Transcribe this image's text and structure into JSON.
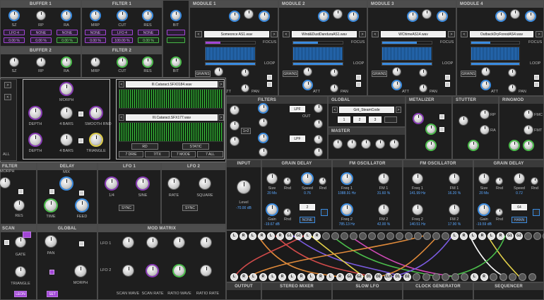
{
  "colors": {
    "purple": "#8a3bb8",
    "green": "#4bbd4b",
    "blue": "#3a8be0",
    "yellow": "#e2d04a",
    "cable_colors": [
      "#e08a3a",
      "#d04a4a",
      "#7a5be0",
      "#e2d04a",
      "#4bbd4b",
      "#d24ab8",
      "#ffffff"
    ]
  },
  "buffer1": {
    "title": "BUFFER 1",
    "knobs": [
      "SZ",
      "RP",
      "RA"
    ],
    "pills": [
      "LFO 4",
      "NONE",
      "NONE"
    ],
    "pcts": [
      "0.00 %",
      "0.00 %",
      "0.00 %"
    ]
  },
  "filter1": {
    "title": "FILTER 1",
    "knobs": [
      "MRP",
      "CUT",
      "RES"
    ],
    "pills": [
      "NONE",
      "LFO 4",
      "NONE"
    ],
    "pcts": [
      "0.00 %",
      "100.00 %",
      "0.00 %"
    ]
  },
  "buffer2": {
    "title": "BUFFER 2",
    "knobs": [
      "SZ",
      "RP",
      "RA"
    ]
  },
  "filter2": {
    "title": "FILTER 2",
    "knobs": [
      "MRP",
      "CUT",
      "RES"
    ]
  },
  "bit": {
    "label": "BIT"
  },
  "modules": [
    {
      "title": "MODULE 1",
      "file": "Someonce AS1.wav",
      "focus": "FOCUS",
      "loop": "LOOP",
      "grains": "GRAINS"
    },
    {
      "title": "MODULE 2",
      "file": "Wind&DustDanduraAS1.wav",
      "focus": "FOCUS",
      "loop": "LOOP",
      "grains": "GRAINS"
    },
    {
      "title": "MODULE 3",
      "file": "WChimeAS14.wav",
      "focus": "FOCUS",
      "loop": "LOOP",
      "grains": "GRAINS"
    },
    {
      "title": "MODULE 4",
      "file": "OutbackDryForestAS4.wav",
      "focus": "FOCUS",
      "loop": "LOOP",
      "grains": "GRAINS"
    }
  ],
  "module_labels": {
    "att": "ATT",
    "pan": "PAN",
    "flt1": "FLT1",
    "m": "M",
    "ft": "FT"
  },
  "sampler": {
    "knobs": [
      "MORPH",
      "DEPTH",
      "4 BARS",
      "SMOOTH RND",
      "DEPTH",
      "4 BARS",
      "TRIANGLE"
    ],
    "files": [
      "III.Cataract.SFX0184.wav",
      "III.Cataract.SFX177.wav"
    ],
    "buttons": [
      "RD",
      "STATIC"
    ],
    "modes": [
      "7 DRIE",
      "7/TX",
      "7 MODE",
      "7 ALL"
    ]
  },
  "filters_panel": {
    "title": "FILTERS",
    "lpf": "LPF",
    "out": "OUT",
    "lpf2": "LPF"
  },
  "global_top": {
    "title": "GLOBAL",
    "value": "Grit_SteamCode",
    "small": [
      "1",
      "2",
      "3"
    ]
  },
  "master": {
    "title": "MASTER"
  },
  "metalizer": {
    "title": "METALIZER"
  },
  "stutter": {
    "title": "STUTTER",
    "labels": [
      "DIV",
      "RP",
      "RA"
    ]
  },
  "ringmod": {
    "title": "RINGMOD",
    "labels": [
      "FMC",
      "FMT"
    ]
  },
  "left_col": {
    "filter": "FILTER",
    "morph": "MORPH",
    "res": "RES",
    "scan": "SCAN",
    "gate": "GATE",
    "triangle": "TRIANGLE",
    "btn": "LEON",
    "all": "ALL"
  },
  "delay": {
    "title": "DELAY",
    "mix": "MIX",
    "time": "TIME",
    "feed": "FEED"
  },
  "lfo1": {
    "title": "LFO 1",
    "knobs": [
      "1/4",
      "SINE"
    ],
    "btn": "SYNC"
  },
  "lfo2": {
    "title": "LFO 2",
    "knobs": [
      "RATE",
      "SQUARE"
    ],
    "btn": "SYNC"
  },
  "global_left": {
    "title": "GLOBAL",
    "pan": "PAN",
    "morph": "MORPH",
    "btn": "SET"
  },
  "mod_matrix": {
    "title": "MOD MATRIX",
    "rows": [
      "LFO 1",
      "LFO 2"
    ],
    "cols": [
      "SCAN WAVE",
      "SCAN RATE",
      "RATIO WAVE",
      "RATIO RATE"
    ]
  },
  "input": {
    "title": "INPUT",
    "level": "Level",
    "value": "-70.00 dB"
  },
  "grain_delay1": {
    "title": "GRAIN DELAY",
    "knobs": [
      "Size",
      "Rnd",
      "Speed",
      "Rnd",
      "Gain",
      "Rnd"
    ],
    "vals": [
      "20 Ms",
      "",
      "0.76",
      "",
      "-19.67 dB",
      ""
    ],
    "mode": "NONE",
    "spin": "2"
  },
  "fm1": {
    "title": "FM OSCILLATOR",
    "knobs": [
      "Freq 1",
      "FM 1",
      "Freq 2",
      "FM 2"
    ],
    "vals": [
      "1088.91 Hz",
      "31.60 %",
      "785.13 Hz",
      "42.00 %"
    ]
  },
  "fm2": {
    "title": "FM OSCILLATOR",
    "knobs": [
      "Freq 1",
      "FM 1",
      "Freq 2",
      "FM 2"
    ],
    "vals": [
      "141.99 Hz",
      "16.20 %",
      "140.51 Hz",
      "17.90 %"
    ]
  },
  "grain_delay2": {
    "title": "GRAIN DELAY",
    "knobs": [
      "Size",
      "Rnd",
      "Speed",
      "Rnd",
      "Gain",
      "Rnd"
    ],
    "vals": [
      "20 Ms",
      "",
      "0.72",
      "",
      "-19.59 dB",
      ""
    ],
    "mode": "HANN",
    "spin": "64"
  },
  "patch_top": [
    "L",
    "R",
    "L",
    "R",
    "L",
    "R",
    "G1",
    "G2",
    "L",
    "R",
    "",
    "",
    "",
    "",
    "",
    "",
    "",
    "",
    "",
    "",
    "",
    "",
    "",
    "",
    "L",
    "R",
    "L",
    "R",
    "L",
    "R",
    "G1",
    "G2",
    "",
    "",
    ""
  ],
  "patch_bot": [
    "L",
    "R",
    "L",
    "R",
    "L",
    "R",
    "L",
    "R",
    "L",
    "R",
    "L",
    "R",
    "G1",
    "G2",
    "D1",
    "D2",
    "CLK",
    "D1",
    "D2",
    "",
    "",
    "",
    "",
    "",
    "",
    "L",
    "R",
    "",
    "",
    "",
    "",
    ""
  ],
  "bottom": [
    "OUTPUT",
    "STEREO MIXER",
    "SLOW LFO",
    "CLOCK GENERATOR",
    "SEQUENCER"
  ]
}
